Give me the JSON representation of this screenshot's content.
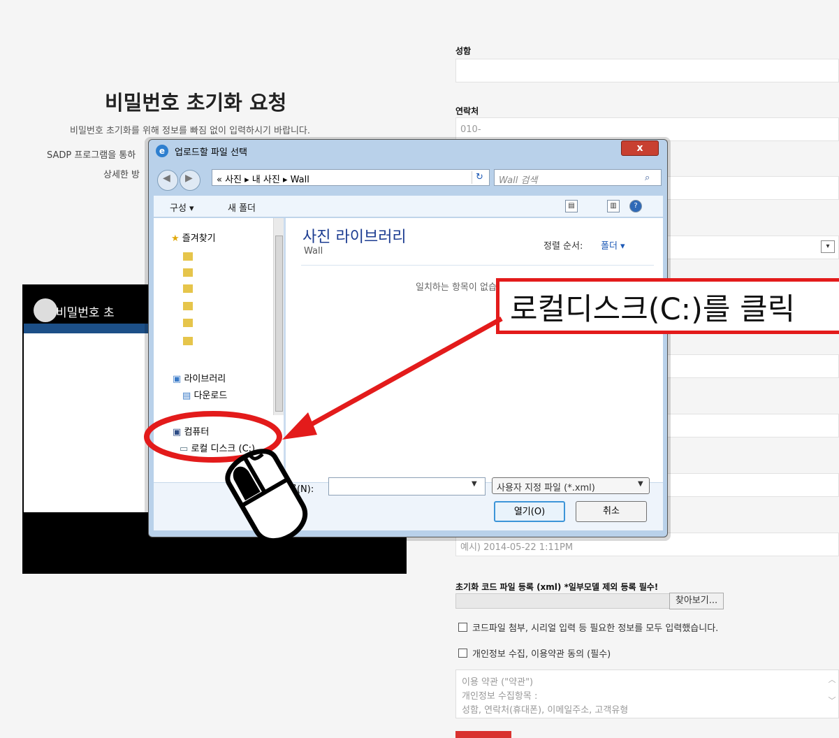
{
  "page": {
    "title": "비밀번호 초기화 요청",
    "subtitle": "비밀번호 초기화를 위해 정보를 빠짐 없이 입력하시기 바랍니다.",
    "line_2_prefix": "SADP 프로그램을 통하",
    "line_3_prefix": "상세한 방",
    "video_title": "비밀번호 초"
  },
  "form": {
    "name_label": "성함",
    "contact_label": "연락처",
    "contact_placeholder": "010-",
    "datetime_placeholder": "예시) 2014-05-22 1:11PM",
    "file_label": "초기화 코드 파일 등록 (xml) *일부모델 제외 등록 필수!",
    "browse_button": "찾아보기...",
    "checkbox_all_info": "코드파일 첨부, 시리얼 입력 등 필요한 정보를 모두 입력했습니다.",
    "checkbox_privacy": "개인정보 수집, 이용약관 동의 (필수)",
    "terms_line_1": "이용 약관 (\"약관\")",
    "terms_line_2": "개인정보 수집항목 :",
    "terms_line_3": "성함, 연락처(휴대폰), 이메일주소, 고객유형"
  },
  "dialog": {
    "title": "업로드할 파일 선택",
    "address_path": "« 사진 ▸ 내 사진 ▸ Wall",
    "search_placeholder": "Wall 검색",
    "toolbar_organize": "구성 ▾",
    "toolbar_new_folder": "새 폴더",
    "nav": {
      "favorites": "즐겨찾기",
      "libraries": "라이브러리",
      "downloads": "다운로드",
      "computer": "컴퓨터",
      "local_disk": "로컬 디스크 (C:)"
    },
    "library_title": "사진 라이브러리",
    "library_sub": "Wall",
    "sort_label": "정렬 순서:",
    "sort_value": "폴더 ▾",
    "empty_message": "일치하는 항목이 없습니다.",
    "filename_label": "파일 이름(N):",
    "filetype": "사용자 지정 파일 (*.xml)",
    "open_button": "열기(O)",
    "cancel_button": "취소",
    "close_button": "x"
  },
  "callout": {
    "text": "로컬디스크(C:)를 클릭"
  },
  "colors": {
    "accent_red": "#e31b1b",
    "dialog_blue": "#b9d1ea",
    "link_blue": "#1c59b6",
    "submit_red": "#d9322f"
  }
}
